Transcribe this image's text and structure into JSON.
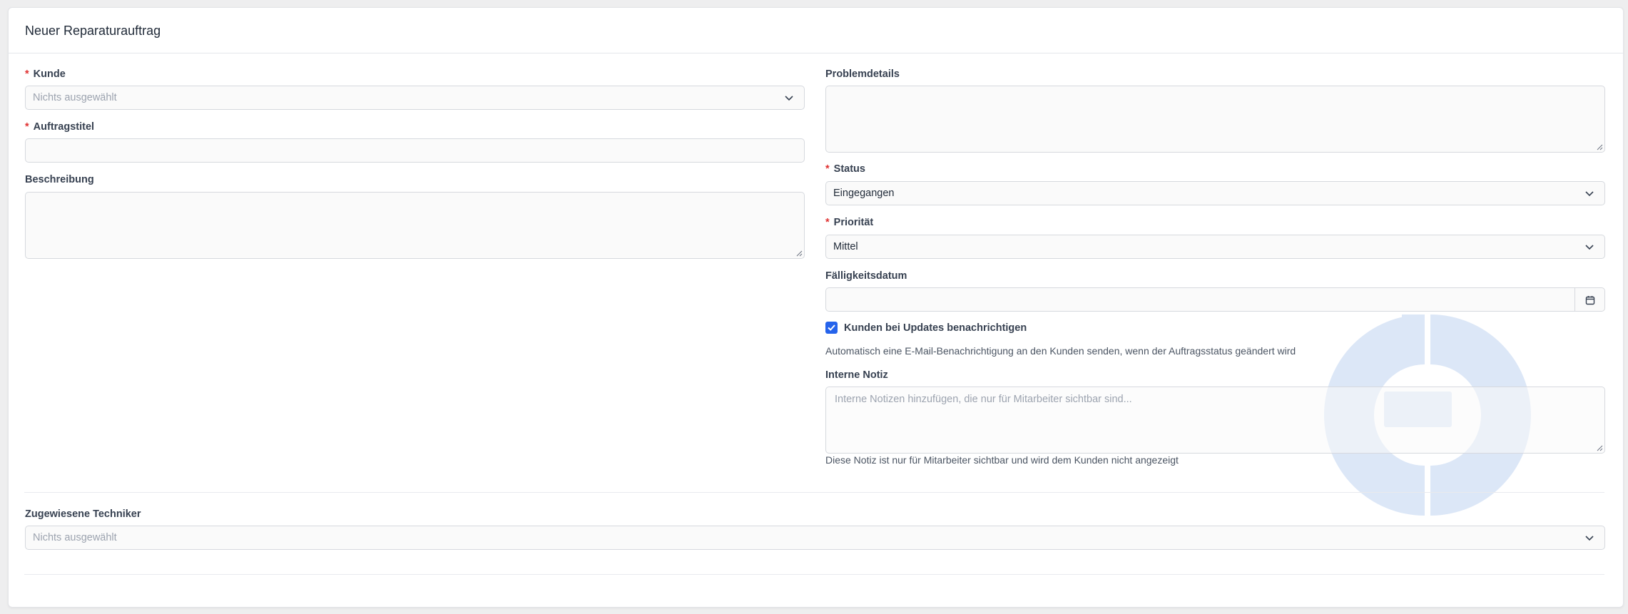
{
  "form": {
    "title": "Neuer Reparaturauftrag",
    "customer": {
      "label": "Kunde",
      "required_mark": "*",
      "placeholder": "Nichts ausgewählt"
    },
    "order_title": {
      "label": "Auftragstitel",
      "required_mark": "*",
      "value": ""
    },
    "description": {
      "label": "Beschreibung",
      "value": ""
    },
    "problem_details": {
      "label": "Problemdetails",
      "value": ""
    },
    "status": {
      "label": "Status",
      "required_mark": "*",
      "value": "Eingegangen"
    },
    "priority": {
      "label": "Priorität",
      "required_mark": "*",
      "value": "Mittel"
    },
    "due_date": {
      "label": "Fälligkeitsdatum",
      "value": ""
    },
    "notify": {
      "label": "Kunden bei Updates benachrichtigen",
      "checked": true,
      "help": "Automatisch eine E-Mail-Benachrichtigung an den Kunden senden, wenn der Auftragsstatus geändert wird"
    },
    "internal_note": {
      "label": "Interne Notiz",
      "placeholder": "Interne Notizen hinzufügen, die nur für Mitarbeiter sichtbar sind...",
      "help": "Diese Notiz ist nur für Mitarbeiter sichtbar und wird dem Kunden nicht angezeigt"
    },
    "technicians": {
      "label": "Zugewiesene Techniker",
      "placeholder": "Nichts ausgewählt"
    }
  },
  "colors": {
    "accent": "#2563eb",
    "required": "#e03131",
    "watermark": "#dce7f7",
    "field_background": "#fafafa",
    "field_border": "#d6d9de"
  },
  "icons": {
    "select": "chevron-down-icon",
    "date": "calendar-icon",
    "check": "checkmark-icon",
    "watermark": "logo-watermark"
  }
}
